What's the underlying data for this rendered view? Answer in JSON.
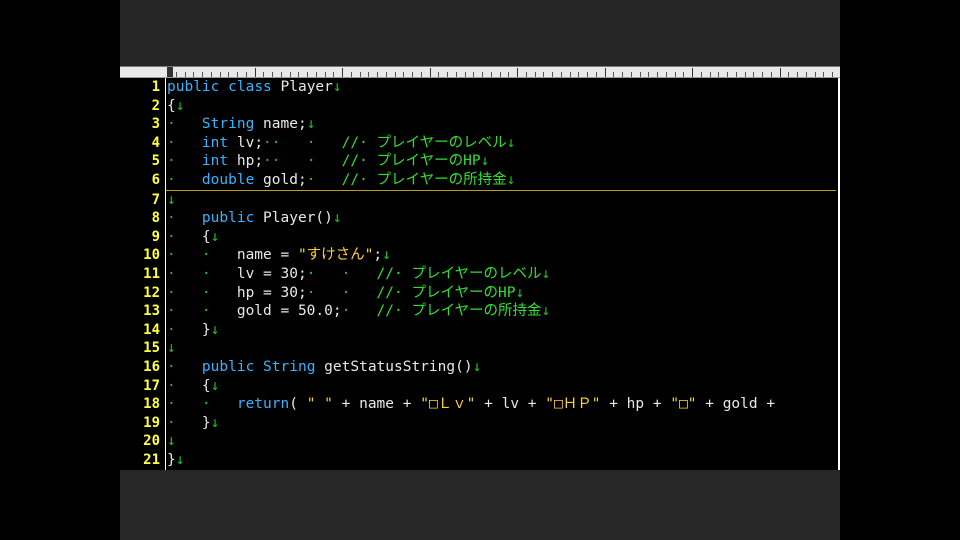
{
  "lines": [
    {
      "num": "1",
      "tokens": [
        [
          "kw",
          "public"
        ],
        [
          "tx",
          " "
        ],
        [
          "kw",
          "class"
        ],
        [
          "tx",
          " Player"
        ],
        [
          "ws",
          "↓"
        ]
      ]
    },
    {
      "num": "2",
      "tokens": [
        [
          "tx",
          "{"
        ],
        [
          "ws",
          "↓"
        ]
      ]
    },
    {
      "num": "3",
      "tokens": [
        [
          "ws",
          "·   "
        ],
        [
          "ty",
          "String"
        ],
        [
          "tx",
          " name;"
        ],
        [
          "ws",
          "↓"
        ]
      ]
    },
    {
      "num": "4",
      "tokens": [
        [
          "ws",
          "·   "
        ],
        [
          "ty",
          "int"
        ],
        [
          "tx",
          " lv;"
        ],
        [
          "ws",
          "··   ·   "
        ],
        [
          "cm",
          "//· プレイヤーのレベル"
        ],
        [
          "ws",
          "↓"
        ]
      ]
    },
    {
      "num": "5",
      "tokens": [
        [
          "ws",
          "·   "
        ],
        [
          "ty",
          "int"
        ],
        [
          "tx",
          " hp;"
        ],
        [
          "ws",
          "··   ·   "
        ],
        [
          "cm",
          "//· プレイヤーのHP"
        ],
        [
          "ws",
          "↓"
        ]
      ]
    },
    {
      "num": "6",
      "tokens": [
        [
          "ws",
          "·   "
        ],
        [
          "ty",
          "double"
        ],
        [
          "tx",
          " gold;"
        ],
        [
          "ws",
          "·   "
        ],
        [
          "cm",
          "//· プレイヤーの所持金"
        ],
        [
          "ws",
          "↓"
        ]
      ]
    },
    {
      "num": "7",
      "tokens": [
        [
          "ws",
          "↓"
        ]
      ]
    },
    {
      "num": "8",
      "tokens": [
        [
          "ws",
          "·   "
        ],
        [
          "kw",
          "public"
        ],
        [
          "tx",
          " Player()"
        ],
        [
          "ws",
          "↓"
        ]
      ]
    },
    {
      "num": "9",
      "tokens": [
        [
          "ws",
          "·   "
        ],
        [
          "tx",
          "{"
        ],
        [
          "ws",
          "↓"
        ]
      ]
    },
    {
      "num": "10",
      "tokens": [
        [
          "ws",
          "·   ·   "
        ],
        [
          "tx",
          "name = "
        ],
        [
          "st",
          "\"すけさん\""
        ],
        [
          "tx",
          ";"
        ],
        [
          "ws",
          "↓"
        ]
      ]
    },
    {
      "num": "11",
      "tokens": [
        [
          "ws",
          "·   ·   "
        ],
        [
          "tx",
          "lv = 30;"
        ],
        [
          "ws",
          "·   ·   "
        ],
        [
          "cm",
          "//· プレイヤーのレベル"
        ],
        [
          "ws",
          "↓"
        ]
      ]
    },
    {
      "num": "12",
      "tokens": [
        [
          "ws",
          "·   ·   "
        ],
        [
          "tx",
          "hp = 30;"
        ],
        [
          "ws",
          "·   ·   "
        ],
        [
          "cm",
          "//· プレイヤーのHP"
        ],
        [
          "ws",
          "↓"
        ]
      ]
    },
    {
      "num": "13",
      "tokens": [
        [
          "ws",
          "·   ·   "
        ],
        [
          "tx",
          "gold = 50.0;"
        ],
        [
          "ws",
          "·   "
        ],
        [
          "cm",
          "//· プレイヤーの所持金"
        ],
        [
          "ws",
          "↓"
        ]
      ]
    },
    {
      "num": "14",
      "tokens": [
        [
          "ws",
          "·   "
        ],
        [
          "tx",
          "}"
        ],
        [
          "ws",
          "↓"
        ]
      ]
    },
    {
      "num": "15",
      "tokens": [
        [
          "ws",
          "↓"
        ]
      ]
    },
    {
      "num": "16",
      "tokens": [
        [
          "ws",
          "·   "
        ],
        [
          "kw",
          "public"
        ],
        [
          "tx",
          " "
        ],
        [
          "ty",
          "String"
        ],
        [
          "tx",
          " getStatusString()"
        ],
        [
          "ws",
          "↓"
        ]
      ]
    },
    {
      "num": "17",
      "tokens": [
        [
          "ws",
          "·   "
        ],
        [
          "tx",
          "{"
        ],
        [
          "ws",
          "↓"
        ]
      ]
    },
    {
      "num": "18",
      "tokens": [
        [
          "ws",
          "·   ·   "
        ],
        [
          "kw",
          "return"
        ],
        [
          "tx",
          "( "
        ],
        [
          "st",
          "\" \""
        ],
        [
          "tx",
          " + name + "
        ],
        [
          "st",
          "\"□Ｌｖ\""
        ],
        [
          "tx",
          " + lv + "
        ],
        [
          "st",
          "\"□ＨＰ\""
        ],
        [
          "tx",
          " + hp + "
        ],
        [
          "st",
          "\"□\""
        ],
        [
          "tx",
          " + gold +"
        ]
      ]
    },
    {
      "num": "19",
      "tokens": [
        [
          "ws",
          "·   "
        ],
        [
          "tx",
          "}"
        ],
        [
          "ws",
          "↓"
        ]
      ]
    },
    {
      "num": "20",
      "tokens": [
        [
          "ws",
          "↓"
        ]
      ]
    },
    {
      "num": "21",
      "tokens": [
        [
          "tx",
          "}"
        ],
        [
          "ws",
          "↓"
        ]
      ]
    }
  ]
}
